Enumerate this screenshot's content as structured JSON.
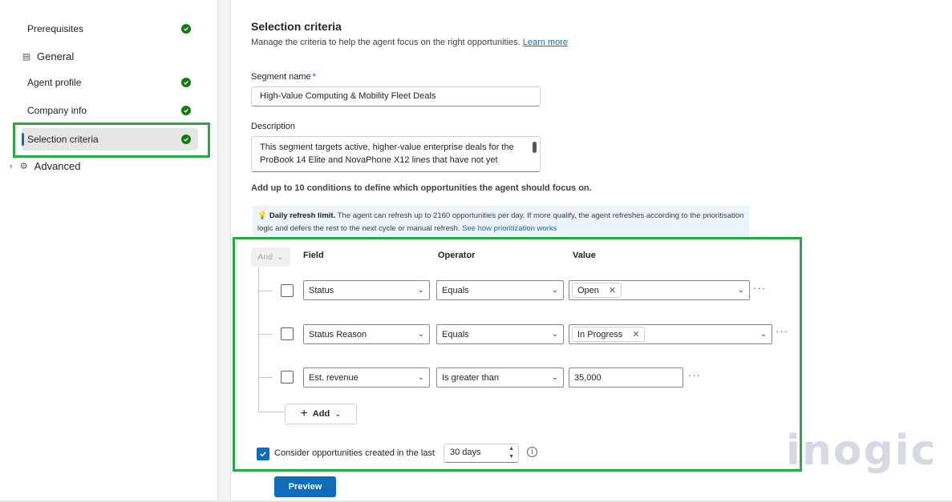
{
  "sidebar": {
    "items": [
      {
        "label": "Prerequisites"
      },
      {
        "label": "Agent profile"
      },
      {
        "label": "Company info"
      },
      {
        "label": "Selection criteria"
      }
    ],
    "groups": {
      "general": "General",
      "advanced": "Advanced"
    }
  },
  "main": {
    "title": "Selection criteria",
    "subtitle": "Manage the criteria to help the agent focus on the right opportunities.",
    "learn_more": "Learn more",
    "segment_label": "Segment name",
    "required_mark": "*",
    "segment_value": "High-Value Computing & Mobility Fleet Deals",
    "description_label": "Description",
    "description_value": "This segment targets active, higher-value enterprise deals for the ProBook 14 Elite and NovaPhone X12 lines that have not yet",
    "instructions": "Add up to 10 conditions to define which opportunities the agent should focus on.",
    "banner": {
      "title": "Daily refresh limit.",
      "text": "The agent can refresh up to 2160 opportunities per day. If more qualify, the agent refreshes according to the prioritisation logic and defers the rest to the next cycle or manual refresh.",
      "link": "See how prioritization works"
    }
  },
  "conditions": {
    "group_operator": "And",
    "headers": {
      "field": "Field",
      "operator": "Operator",
      "value": "Value"
    },
    "rows": [
      {
        "field": "Status",
        "operator": "Equals",
        "value": "Open"
      },
      {
        "field": "Status Reason",
        "operator": "Equals",
        "value": "In Progress"
      },
      {
        "field": "Est. revenue",
        "operator": "Is greater than",
        "value": "35,000"
      }
    ],
    "add_label": "Add",
    "consider_label": "Consider opportunities created in the last",
    "consider_value": "30 days",
    "consider_checked": true
  },
  "preview_label": "Preview",
  "watermark": "inogic",
  "colors": {
    "accent": "#0f6cbd",
    "success": "#107c10",
    "highlight": "#2aa844"
  }
}
